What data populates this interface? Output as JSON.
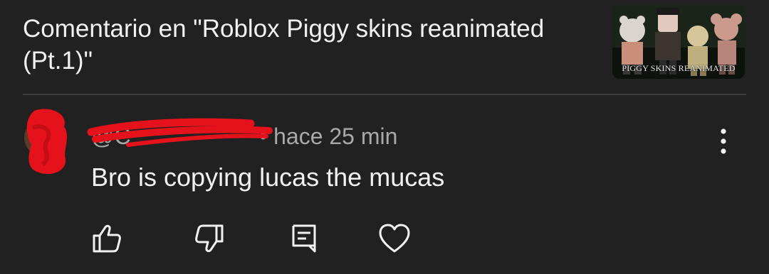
{
  "header": {
    "title": "Comentario en \"Roblox Piggy skins reanimated (Pt.1)\""
  },
  "thumbnail": {
    "caption": "PIGGY SKINS REANIMATED",
    "icon": "video-thumbnail"
  },
  "comment": {
    "author_handle": "@C",
    "author_redacted": true,
    "separator": "•",
    "time": "hace 25 min",
    "text": "Bro is copying lucas the mucas",
    "avatar_icon": "avatar-redacted"
  },
  "actions": {
    "like_icon": "thumbs-up-icon",
    "dislike_icon": "thumbs-down-icon",
    "reply_icon": "comment-icon",
    "heart_icon": "heart-icon",
    "more_icon": "more-vertical-icon"
  },
  "colors": {
    "background": "#212121",
    "text_primary": "#f1f1f1",
    "text_secondary": "#a9a9a9",
    "redaction": "#e5121b",
    "divider": "#3d3d3d"
  }
}
